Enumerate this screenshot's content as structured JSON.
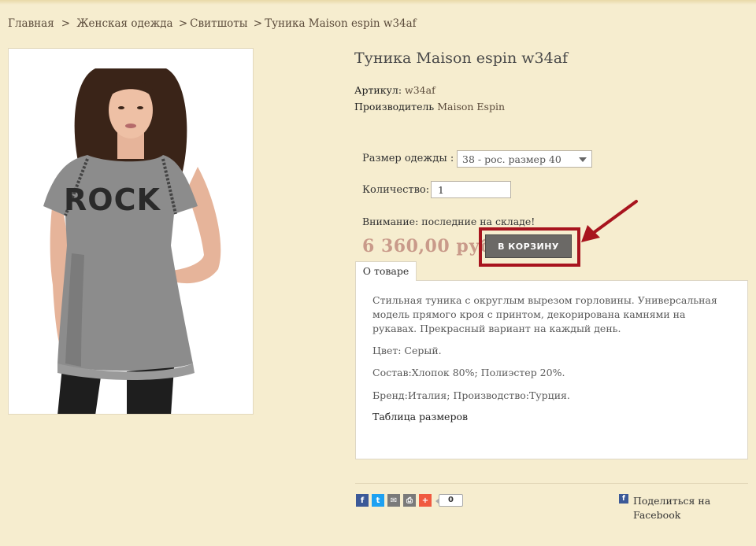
{
  "breadcrumb": {
    "home": "Главная",
    "category": "Женская одежда",
    "subcategory": "Свитшоты",
    "current": "Туника Maison espin w34af",
    "separator": ">"
  },
  "product": {
    "title": "Туника Maison espin w34af",
    "article_label": "Артикул:",
    "article_value": "w34af",
    "maker_label": "Производитель",
    "maker_value": "Maison Espin",
    "photo_print_text": "ROCK"
  },
  "options": {
    "size_label": "Размер одежды :",
    "size_selected": "38 - рос. размер 40",
    "qty_label": "Количество:",
    "qty_value": "1"
  },
  "notice": "Внимание: последние на складе!",
  "price": "6 360,00 руб",
  "cart_button": "В КОРЗИНУ",
  "tab_label": "О товаре",
  "description": {
    "p1": "Стильная туника с округлым вырезом горловины. Универсальная модель прямого кроя с принтом, декорирована камнями на рукавах. Прекрасный вариант на каждый день.",
    "color": "Цвет: Серый.",
    "composition": "Состав:Хлопок 80%; Полиэстер 20%.",
    "brand": "Бренд:Италия; Производство:Турция.",
    "size_table_link": "Таблица размеров"
  },
  "share": {
    "icons": [
      "facebook-icon",
      "twitter-icon",
      "mail-icon",
      "print-icon",
      "more-plus-icon"
    ],
    "count": "0",
    "facebook_label": "Поделиться на Facebook"
  },
  "colors": {
    "background": "#f6edcf",
    "price": "#c99a8a",
    "highlight": "#a8141e",
    "button": "#6b6966"
  }
}
